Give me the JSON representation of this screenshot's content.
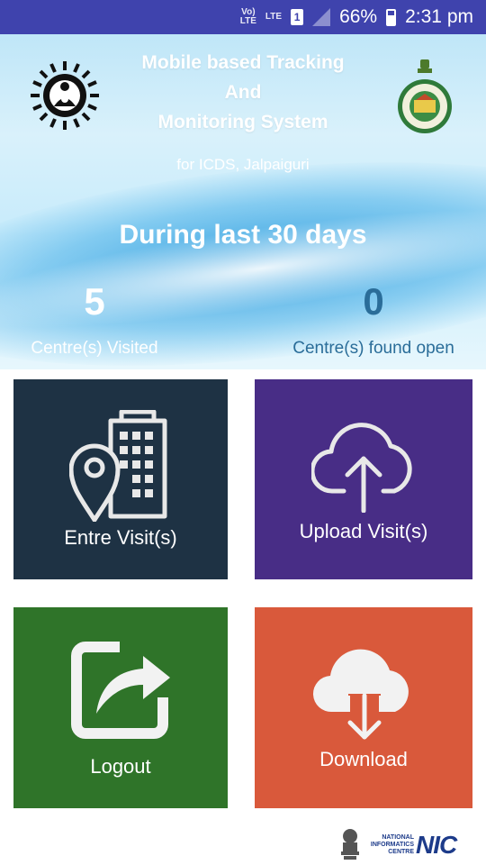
{
  "status_bar": {
    "volte": "Vo) LTE",
    "lte": "LTE",
    "sim": "1",
    "battery": "66%",
    "time": "2:31 pm",
    "icons": [
      "volte-icon",
      "lte-icon",
      "sim-icon",
      "signal-icon",
      "battery-icon"
    ]
  },
  "header": {
    "title_line1": "Mobile based Tracking",
    "title_line2": "And",
    "title_line3": "Monitoring System",
    "subtitle": "for ICDS, Jalpaiguri",
    "left_logo": "icds-logo",
    "right_logo": "west-bengal-emblem"
  },
  "summary": {
    "period": "During last 30 days",
    "visited_count": "5",
    "visited_label": "Centre(s) Visited",
    "open_count": "0",
    "open_label": "Centre(s) found open"
  },
  "tiles": {
    "visit": {
      "label": "Entre Visit(s)",
      "icon": "location-building-icon",
      "color": "#1e3244"
    },
    "upload": {
      "label": "Upload Visit(s)",
      "icon": "cloud-upload-icon",
      "color": "#482d86"
    },
    "logout": {
      "label": "Logout",
      "icon": "share-exit-icon",
      "color": "#2f7429"
    },
    "download": {
      "label": "Download",
      "icon": "cloud-download-icon",
      "color": "#d9593b"
    }
  },
  "footer": {
    "nic_line1": "NATIONAL",
    "nic_line2": "INFORMATICS",
    "nic_line3": "CENTRE",
    "nic_mark": "NIC"
  }
}
